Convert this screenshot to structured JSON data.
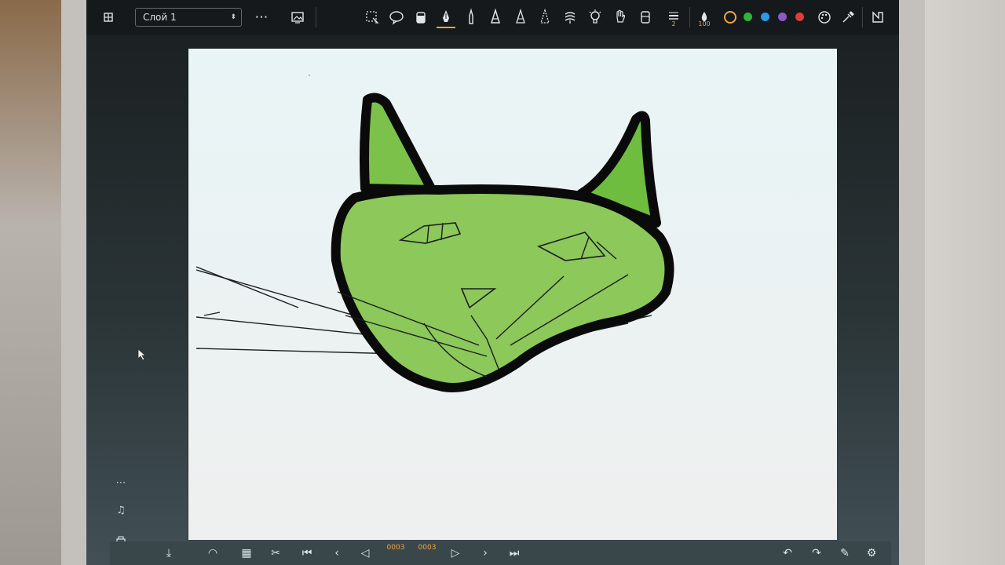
{
  "toolbar": {
    "layer_select": "Слой 1",
    "brush_size": "2",
    "opacity": "100",
    "icons": [
      "grid-icon",
      "more-icon",
      "gallery-icon",
      "lasso-select-icon",
      "speech-bubble-icon",
      "fill-bucket-icon",
      "pen-icon",
      "pencil-icon",
      "marker-icon",
      "brush-icon",
      "airbrush-icon",
      "smudge-icon",
      "bulb-icon",
      "hand-icon",
      "eraser-icon",
      "size-icon",
      "opacity-icon",
      "color-ring-icon",
      "palette-icon",
      "eyedropper-icon",
      "transform-icon"
    ],
    "swatches": [
      "#2fb33a",
      "#2c98e8",
      "#8e58c8",
      "#e23b3b"
    ],
    "ring_color": "#f0a63b"
  },
  "bottom_bar": {
    "frame_current": "0003",
    "frame_total": "0003",
    "icons": [
      "add-frame-icon",
      "onion-icon",
      "frames-icon",
      "cut-icon",
      "first-frame-icon",
      "prev-frame-icon",
      "prev-icon",
      "play-icon",
      "next-icon",
      "last-frame-icon",
      "undo-icon",
      "redo-icon",
      "pen-mode-icon",
      "settings-icon"
    ]
  },
  "side_toolbar": {
    "icons": [
      "more-icon",
      "music-note-icon",
      "layers-icon"
    ]
  },
  "drawing": {
    "subject": "cat-head",
    "fill_color": "#8cc85a",
    "outline_color": "#0a0a0a"
  }
}
